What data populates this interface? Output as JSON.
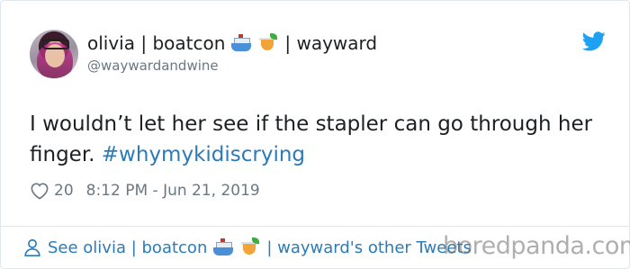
{
  "tweet": {
    "display_name_before": "olivia | boatcon",
    "display_name_after": "| wayward",
    "handle": "@waywardandwine",
    "text_before": "I wouldn’t let her see if the stapler can go through her finger. ",
    "hashtag": "#whymykidiscrying",
    "like_count": "20",
    "timestamp": "8:12 PM - Jun 21, 2019"
  },
  "footer": {
    "link_before": "See olivia | boatcon",
    "link_after": "| wayward's other Tweets"
  },
  "watermark": "boredpanda.com",
  "icons": {
    "brand": "twitter-bird-icon",
    "like": "heart-icon",
    "profile": "person-icon",
    "emoji_1": "ship-emoji",
    "emoji_2": "tropical-drink-emoji"
  },
  "colors": {
    "link": "#2b7bb9",
    "text": "#1c2022",
    "muted": "#697882",
    "twitter_blue": "#1da1f2"
  }
}
